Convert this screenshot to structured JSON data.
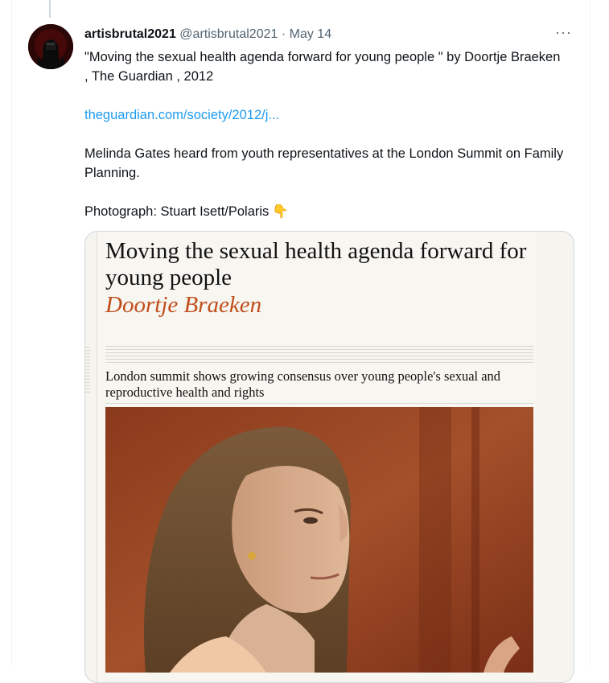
{
  "tweet": {
    "author_name": "artisbrutal2021",
    "handle": "@artisbrutal2021",
    "separator": "·",
    "date": "May 14",
    "more_label": "···",
    "text_line1": "\"Moving the sexual health agenda forward for young people \" by Doortje Braeken , The Guardian , 2012",
    "link": "theguardian.com/society/2012/j...",
    "text_line2": "Melinda Gates heard from youth representatives at the London Summit on Family Planning.",
    "text_line3": "Photograph: Stuart Isett/Polaris",
    "emoji": "👇"
  },
  "card": {
    "headline": "Moving the sexual health agenda forward for young people",
    "byline": "Doortje Braeken",
    "standfirst": "London summit shows growing consensus over young people's sexual and reproductive health and rights"
  },
  "colors": {
    "link": "#1d9bf0",
    "byline": "#c04e1b",
    "text": "#0f1419",
    "muted": "#536471"
  },
  "icons": {
    "avatar": "hooded-figure-avatar",
    "more": "more-options-icon",
    "emoji": "pointing-down-emoji"
  }
}
